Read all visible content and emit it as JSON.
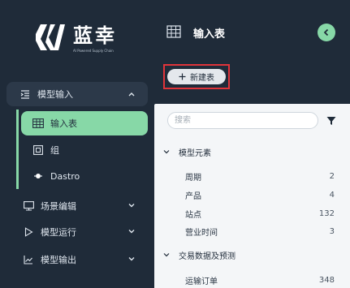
{
  "logo": {
    "text": "蓝幸",
    "subtitle": "AI Powered Supply Chain"
  },
  "sidebar": {
    "groups": [
      {
        "label": "模型输入",
        "expanded": true,
        "items": [
          {
            "label": "输入表",
            "icon": "table-icon",
            "active": true
          },
          {
            "label": "组",
            "icon": "group-icon"
          },
          {
            "label": "Dastro",
            "icon": "dastro-icon"
          }
        ]
      },
      {
        "label": "场景编辑",
        "icon": "scene-icon"
      },
      {
        "label": "模型运行",
        "icon": "play-icon"
      },
      {
        "label": "模型输出",
        "icon": "chart-line-icon"
      }
    ]
  },
  "panel": {
    "title": "输入表",
    "new_button": "新建表",
    "search_placeholder": "搜索",
    "sections": [
      {
        "label": "模型元素",
        "rows": [
          {
            "label": "周期",
            "count": "2"
          },
          {
            "label": "产品",
            "count": "4"
          },
          {
            "label": "站点",
            "count": "132"
          },
          {
            "label": "营业时间",
            "count": "3"
          }
        ]
      },
      {
        "label": "交易数据及预测",
        "rows": [
          {
            "label": "运输订单",
            "count": "348"
          }
        ]
      }
    ]
  },
  "colors": {
    "sidebar_bg": "#1f2b39",
    "accent": "#87d8a7",
    "highlight_border": "#e0343a",
    "panel_bg": "#f4f6f8"
  }
}
